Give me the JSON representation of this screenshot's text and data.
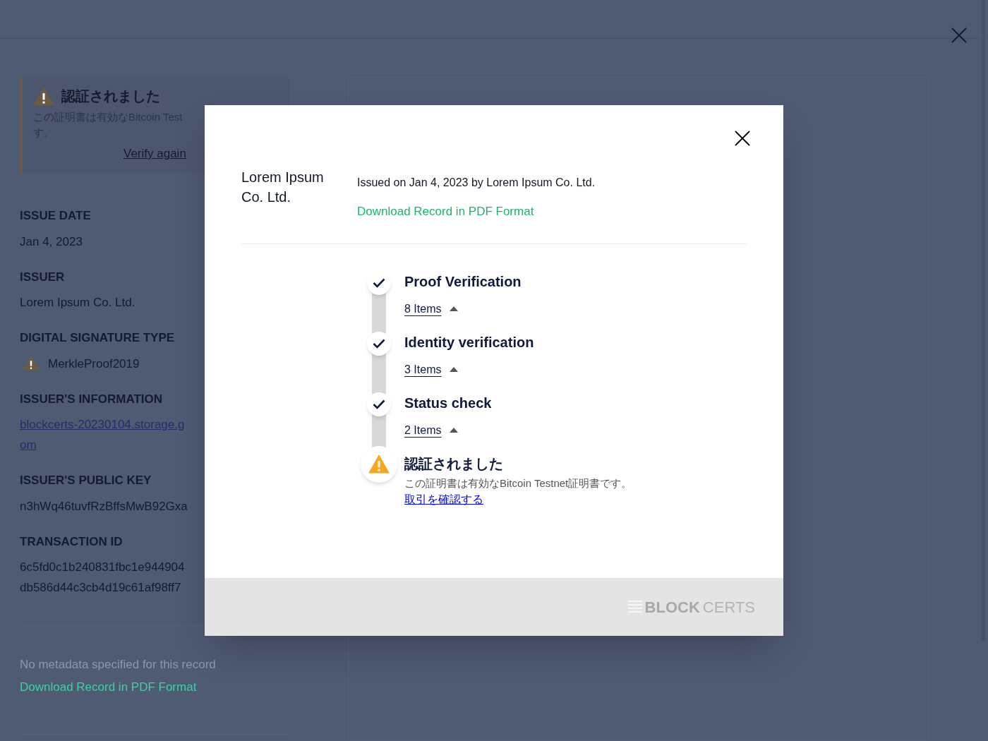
{
  "background": {
    "alert": {
      "title": "認証されました",
      "lines": [
        "この証明書は有効なBitcoin Test",
        "す。"
      ],
      "link": "Verify again"
    },
    "fields": [
      {
        "label": "ISSUE DATE",
        "lines": [
          "Jan 4, 2023"
        ],
        "kind": "text"
      },
      {
        "label": "ISSUER",
        "lines": [
          "Lorem Ipsum Co. Ltd."
        ],
        "kind": "text"
      },
      {
        "label": "DIGITAL SIGNATURE TYPE",
        "lines": [
          "MerkleProof2019"
        ],
        "kind": "warning"
      },
      {
        "label": "ISSUER'S INFORMATION",
        "lines": [
          "blockcerts-20230104.storage.g",
          "om"
        ],
        "kind": "link"
      },
      {
        "label": "ISSUER'S PUBLIC KEY",
        "lines": [
          "n3hWq46tuvfRzBffsMwB92Gxa"
        ],
        "kind": "text"
      },
      {
        "label": "TRANSACTION ID",
        "lines": [
          "6c5fd0c1b240831fbc1e944904",
          "db586d44c3cb4d19c61af98ff7"
        ],
        "kind": "text"
      }
    ],
    "metadata": "No metadata specified for this record",
    "download": "Download Record in PDF Format"
  },
  "modal": {
    "issuer": "Lorem Ipsum Co. Ltd.",
    "issued": "Issued on Jan 4, 2023 by Lorem Ipsum Co. Ltd.",
    "download": "Download Record in PDF Format",
    "steps": [
      {
        "kind": "check",
        "title": "Proof Verification",
        "items": "8 Items",
        "expanded": false
      },
      {
        "kind": "check",
        "title": "Identity verification",
        "items": "3 Items",
        "expanded": false
      },
      {
        "kind": "check",
        "title": "Status check",
        "items": "2 Items",
        "expanded": false
      },
      {
        "kind": "warning",
        "title": "認証されました",
        "description": "この証明書は有効なBitcoin Testnet証明書です。",
        "link": "取引を確認する"
      }
    ],
    "footer_logo": {
      "bold": "BLOCK",
      "light": "CERTS"
    }
  }
}
